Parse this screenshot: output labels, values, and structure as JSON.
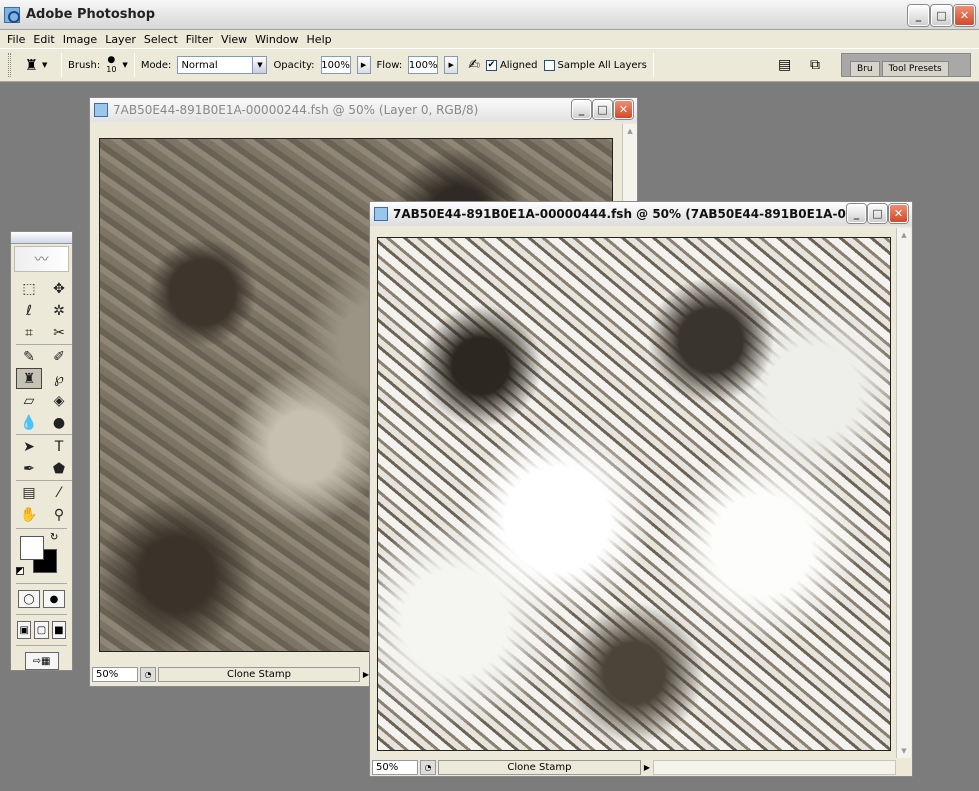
{
  "app": {
    "title": "Adobe Photoshop"
  },
  "window_buttons": {
    "minimize": "_",
    "maximize": "□",
    "close": "✕"
  },
  "menu": [
    "File",
    "Edit",
    "Image",
    "Layer",
    "Select",
    "Filter",
    "View",
    "Window",
    "Help"
  ],
  "options": {
    "brush_label": "Brush:",
    "brush_size": "10",
    "mode_label": "Mode:",
    "mode_value": "Normal",
    "opacity_label": "Opacity:",
    "opacity_value": "100%",
    "flow_label": "Flow:",
    "flow_value": "100%",
    "aligned_label": "Aligned",
    "aligned_checked": true,
    "sample_label": "Sample All Layers",
    "sample_checked": false
  },
  "palette_well": {
    "tabs": [
      "Bru",
      "Tool Presets"
    ]
  },
  "doc1": {
    "title": "7AB50E44-891B0E1A-00000244.fsh @ 50% (Layer 0, RGB/8)",
    "zoom": "50%",
    "status": "Clone Stamp"
  },
  "doc2": {
    "title": "7AB50E44-891B0E1A-00000444.fsh @ 50% (7AB50E44-891B0E1A-0...",
    "zoom": "50%",
    "status": "Clone Stamp"
  },
  "toolbox": {
    "tools": [
      {
        "name": "marquee-tool",
        "glyph": "⬚"
      },
      {
        "name": "move-tool",
        "glyph": "✥"
      },
      {
        "name": "lasso-tool",
        "glyph": "ℓ"
      },
      {
        "name": "magic-wand-tool",
        "glyph": "✲"
      },
      {
        "name": "crop-tool",
        "glyph": "⌗"
      },
      {
        "name": "slice-tool",
        "glyph": "✂"
      },
      {
        "name": "healing-brush-tool",
        "glyph": "✎"
      },
      {
        "name": "brush-tool",
        "glyph": "✐"
      },
      {
        "name": "clone-stamp-tool",
        "glyph": "♜"
      },
      {
        "name": "history-brush-tool",
        "glyph": "℘"
      },
      {
        "name": "eraser-tool",
        "glyph": "▱"
      },
      {
        "name": "paint-bucket-tool",
        "glyph": "◈"
      },
      {
        "name": "blur-tool",
        "glyph": "💧"
      },
      {
        "name": "dodge-tool",
        "glyph": "●"
      },
      {
        "name": "path-select-tool",
        "glyph": "➤"
      },
      {
        "name": "type-tool",
        "glyph": "T"
      },
      {
        "name": "pen-tool",
        "glyph": "✒"
      },
      {
        "name": "shape-tool",
        "glyph": "⬟"
      },
      {
        "name": "notes-tool",
        "glyph": "▤"
      },
      {
        "name": "eyedropper-tool",
        "glyph": "⁄"
      },
      {
        "name": "hand-tool",
        "glyph": "✋"
      },
      {
        "name": "zoom-tool",
        "glyph": "⚲"
      }
    ]
  }
}
